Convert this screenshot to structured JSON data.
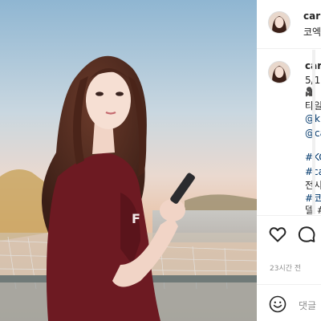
{
  "post": {
    "username": "carr",
    "header_caption": "코엑"
  },
  "caption": {
    "username": "carr",
    "date": "5/1(",
    "emoji": "🎥",
    "line1": "타일",
    "mention1": "@k",
    "mention2": "@ca",
    "hashtag1": "#KC",
    "hashtag2": "#ca",
    "line2": "전시",
    "hashtag3": "#코",
    "line3": "델 #"
  },
  "actions": {
    "like_icon": "heart-icon",
    "comment_icon": "comment-icon",
    "timestamp": "23시간 전"
  },
  "comment_box": {
    "emoji_icon": "smiley-icon",
    "placeholder": "댓글"
  }
}
